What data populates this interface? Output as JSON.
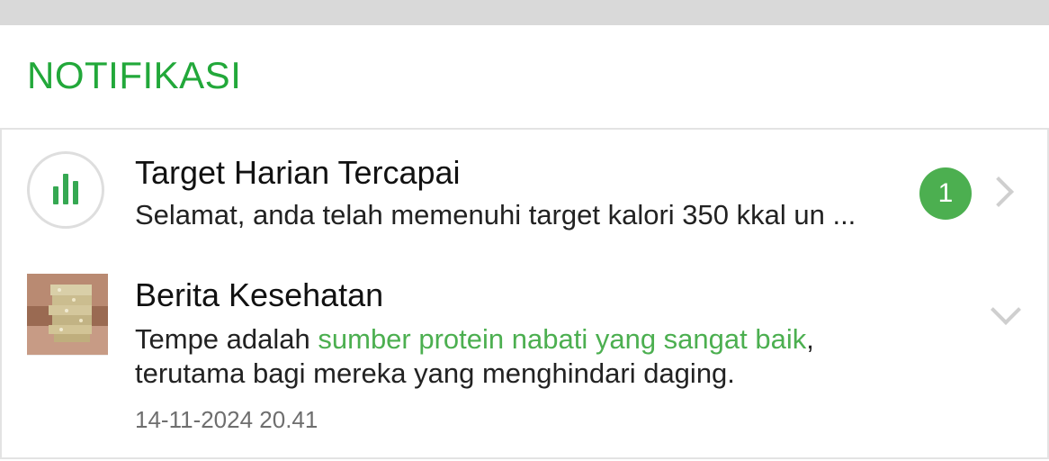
{
  "header": {
    "title": "NOTIFIKASI",
    "accent_color": "#22a83a"
  },
  "notifications": [
    {
      "icon": "bar-chart-icon",
      "title": "Target Harian Tercapai",
      "message": "Selamat, anda telah memenuhi target kalori 350 kkal un  ...",
      "badge_count": "1",
      "badge_color": "#4caf50",
      "indicator": "chevron-right-icon"
    },
    {
      "icon": "news-thumbnail-image",
      "title": "Berita Kesehatan",
      "message_before": "Tempe adalah ",
      "message_highlight": "sumber protein nabati yang sangat baik",
      "message_after": ",",
      "message_line2": "terutama bagi mereka yang menghindari daging.",
      "timestamp": "14-11-2024 20.41",
      "highlight_color": "#4caf50",
      "indicator": "chevron-down-icon"
    }
  ]
}
